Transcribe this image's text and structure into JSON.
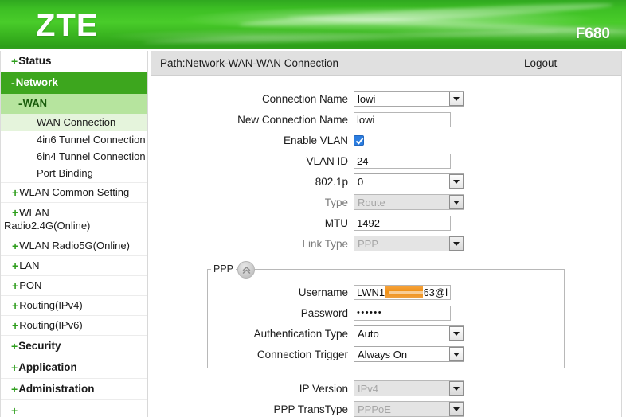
{
  "banner": {
    "logo": "ZTE",
    "model": "F680"
  },
  "sidebar": {
    "items": [
      {
        "label": "Status",
        "icon": "plus-icon",
        "level": 1,
        "state": "collapsed"
      },
      {
        "label": "Network",
        "icon": "minus-icon",
        "level": 1,
        "state": "expanded-active"
      },
      {
        "label": "WAN",
        "icon": "minus-icon",
        "level": 2,
        "state": "expanded-active"
      },
      {
        "label": "WAN Connection",
        "level": 3,
        "state": "selected"
      },
      {
        "label": "4in6 Tunnel Connection",
        "level": 3,
        "state": "normal"
      },
      {
        "label": "6in4 Tunnel Connection",
        "level": 3,
        "state": "normal"
      },
      {
        "label": "Port Binding",
        "level": 3,
        "state": "normal"
      },
      {
        "label": "WLAN Common Setting",
        "icon": "plus-icon",
        "level": 2,
        "state": "collapsed"
      },
      {
        "label": "WLAN Radio2.4G(Online)",
        "icon": "plus-icon",
        "level": 2,
        "state": "collapsed"
      },
      {
        "label": "WLAN Radio5G(Online)",
        "icon": "plus-icon",
        "level": 2,
        "state": "collapsed"
      },
      {
        "label": "LAN",
        "icon": "plus-icon",
        "level": 2,
        "state": "collapsed"
      },
      {
        "label": "PON",
        "icon": "plus-icon",
        "level": 2,
        "state": "collapsed"
      },
      {
        "label": "Routing(IPv4)",
        "icon": "plus-icon",
        "level": 2,
        "state": "collapsed"
      },
      {
        "label": "Routing(IPv6)",
        "icon": "plus-icon",
        "level": 2,
        "state": "collapsed"
      },
      {
        "label": "Security",
        "icon": "plus-icon",
        "level": 1,
        "state": "collapsed"
      },
      {
        "label": "Application",
        "icon": "plus-icon",
        "level": 1,
        "state": "collapsed"
      },
      {
        "label": "Administration",
        "icon": "plus-icon",
        "level": 1,
        "state": "collapsed"
      }
    ],
    "wlan24_line1": "WLAN",
    "wlan24_line2": "Radio2.4G(Online)"
  },
  "pathbar": {
    "path": "Path:Network-WAN-WAN Connection",
    "logout": "Logout"
  },
  "form": {
    "connection_name": {
      "label": "Connection Name",
      "value": "lowi",
      "type": "select",
      "disabled": false
    },
    "new_connection_name": {
      "label": "New Connection Name",
      "value": "lowi",
      "type": "text",
      "disabled": false
    },
    "enable_vlan": {
      "label": "Enable VLAN",
      "checked": true,
      "type": "checkbox"
    },
    "vlan_id": {
      "label": "VLAN ID",
      "value": "24",
      "type": "text",
      "disabled": false
    },
    "dot1p": {
      "label": "802.1p",
      "value": "0",
      "type": "select",
      "disabled": false
    },
    "type": {
      "label": "Type",
      "value": "Route",
      "type": "select",
      "disabled": true
    },
    "mtu": {
      "label": "MTU",
      "value": "1492",
      "type": "text",
      "disabled": false
    },
    "link_type": {
      "label": "Link Type",
      "value": "PPP",
      "type": "select",
      "disabled": true
    }
  },
  "ppp": {
    "legend": "PPP",
    "toggle_icon": "chevron-double-up-icon",
    "username": {
      "label": "Username",
      "prefix": "LWN1",
      "redacted": true,
      "suffix": "63@l"
    },
    "password": {
      "label": "Password",
      "value": "••••••"
    },
    "authentication_type": {
      "label": "Authentication Type",
      "value": "Auto",
      "type": "select",
      "disabled": false
    },
    "connection_trigger": {
      "label": "Connection Trigger",
      "value": "Always On",
      "type": "select",
      "disabled": false
    }
  },
  "bottom": {
    "ip_version": {
      "label": "IP Version",
      "value": "IPv4",
      "type": "select",
      "disabled": true
    },
    "ppp_transtype": {
      "label": "PPP TransType",
      "value": "PPPoE",
      "type": "select",
      "disabled": true
    }
  },
  "colors": {
    "brand_green": "#3dbf24",
    "nav_active_dark": "#3da61e",
    "nav_active_mid": "#b6e49e",
    "nav_active_light": "#e5f4dc",
    "pathbar_bg": "#e0e0e0",
    "redaction_orange": "#ef8f14",
    "checkbox_blue": "#2b7de0"
  }
}
